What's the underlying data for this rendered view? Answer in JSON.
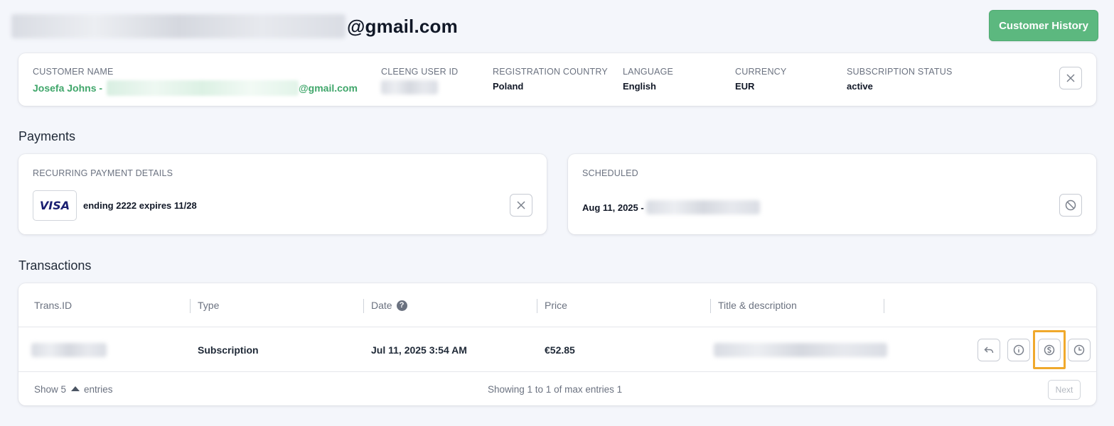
{
  "header": {
    "email_suffix": "@gmail.com",
    "history_button": "Customer History"
  },
  "customer": {
    "name_label": "CUSTOMER NAME",
    "name_prefix": "Josefa Johns -",
    "email_suffix": "@gmail.com",
    "user_id_label": "CLEENG USER ID",
    "country_label": "REGISTRATION COUNTRY",
    "country": "Poland",
    "language_label": "LANGUAGE",
    "language": "English",
    "currency_label": "CURRENCY",
    "currency": "EUR",
    "status_label": "SUBSCRIPTION STATUS",
    "status": "active"
  },
  "payments": {
    "section_title": "Payments",
    "recurring_label": "RECURRING PAYMENT DETAILS",
    "card_brand": "VISA",
    "card_info": "ending 2222 expires 11/28",
    "scheduled_label": "SCHEDULED",
    "scheduled_date": "Aug 11, 2025 -"
  },
  "transactions": {
    "section_title": "Transactions",
    "columns": [
      "Trans.ID",
      "Type",
      "Date",
      "Price",
      "Title & description"
    ],
    "date_help": "?",
    "rows": [
      {
        "type": "Subscription",
        "date": "Jul 11, 2025 3:54 AM",
        "price": "€52.85"
      }
    ],
    "footer": {
      "show": "Show 5",
      "entries": "entries",
      "showing": "Showing 1 to 1 of max entries 1",
      "next": "Next"
    }
  },
  "icons": {
    "close": "close-icon",
    "cancel": "block-icon",
    "refund": "undo-arrow-icon",
    "info": "info-icon",
    "dollar": "dollar-coin-icon",
    "history": "clock-icon"
  }
}
